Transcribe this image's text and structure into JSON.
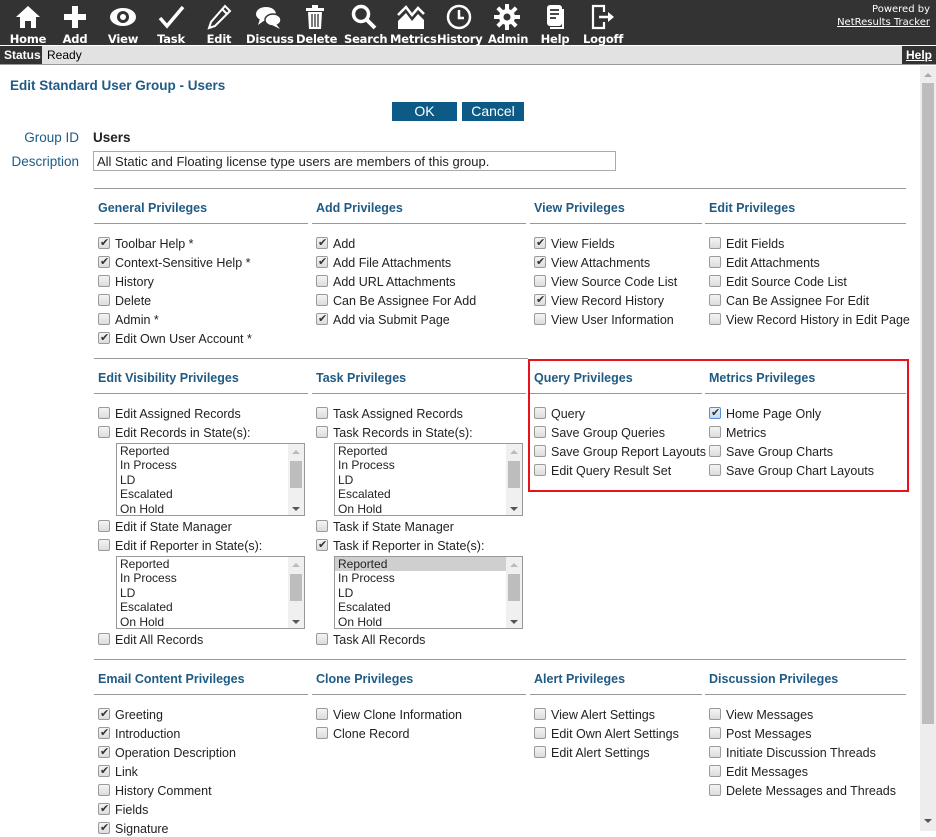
{
  "toolbar": {
    "items": [
      {
        "label": "Home",
        "icon": "home-icon"
      },
      {
        "label": "Add",
        "icon": "plus-icon"
      },
      {
        "label": "View",
        "icon": "eye-icon"
      },
      {
        "label": "Task",
        "icon": "checkmark-icon"
      },
      {
        "label": "Edit",
        "icon": "pencil-icon"
      },
      {
        "label": "Discuss",
        "icon": "chat-bubbles-icon"
      },
      {
        "label": "Delete",
        "icon": "trash-icon"
      },
      {
        "label": "Search",
        "icon": "magnifier-icon"
      },
      {
        "label": "Metrics",
        "icon": "chart-icon"
      },
      {
        "label": "History",
        "icon": "clock-icon"
      },
      {
        "label": "Admin",
        "icon": "gear-icon"
      },
      {
        "label": "Help",
        "icon": "document-icon"
      },
      {
        "label": "Logoff",
        "icon": "logoff-icon"
      }
    ],
    "powered_by": "Powered by",
    "brand_link": "NetResults Tracker"
  },
  "status": {
    "label": "Status",
    "value": "Ready",
    "help": "Help"
  },
  "page": {
    "title": "Edit Standard User Group - Users",
    "ok": "OK",
    "cancel": "Cancel",
    "group_id_label": "Group ID",
    "group_id": "Users",
    "description_label": "Description",
    "description": "All Static and Floating license type users are members of this group."
  },
  "state_options": [
    "Reported",
    "In Process",
    "LD",
    "Escalated",
    "On Hold"
  ],
  "sections": {
    "general": {
      "title": "General Privileges",
      "items": [
        {
          "label": "Toolbar Help *",
          "checked": true
        },
        {
          "label": "Context-Sensitive Help *",
          "checked": true
        },
        {
          "label": "History",
          "checked": false
        },
        {
          "label": "Delete",
          "checked": false
        },
        {
          "label": "Admin *",
          "checked": false
        },
        {
          "label": "Edit Own User Account *",
          "checked": true
        }
      ]
    },
    "add": {
      "title": "Add Privileges",
      "items": [
        {
          "label": "Add",
          "checked": true
        },
        {
          "label": "Add File Attachments",
          "checked": true
        },
        {
          "label": "Add URL Attachments",
          "checked": false
        },
        {
          "label": "Can Be Assignee For Add",
          "checked": false
        },
        {
          "label": "Add via Submit Page",
          "checked": true
        }
      ]
    },
    "view": {
      "title": "View Privileges",
      "items": [
        {
          "label": "View Fields",
          "checked": true
        },
        {
          "label": "View Attachments",
          "checked": true
        },
        {
          "label": "View Source Code List",
          "checked": false
        },
        {
          "label": "View Record History",
          "checked": true
        },
        {
          "label": "View User Information",
          "checked": false
        }
      ]
    },
    "edit": {
      "title": "Edit Privileges",
      "items": [
        {
          "label": "Edit Fields",
          "checked": false
        },
        {
          "label": "Edit Attachments",
          "checked": false
        },
        {
          "label": "Edit Source Code List",
          "checked": false
        },
        {
          "label": "Can Be Assignee For Edit",
          "checked": false
        },
        {
          "label": "View Record History in Edit Page",
          "checked": false
        }
      ]
    },
    "edit_visibility": {
      "title": "Edit Visibility Privileges",
      "items": [
        {
          "label": "Edit Assigned Records",
          "checked": false
        },
        {
          "label": "Edit Records in State(s):",
          "checked": false
        },
        {
          "label": "Edit if State Manager",
          "checked": false
        },
        {
          "label": "Edit if Reporter in State(s):",
          "checked": false
        },
        {
          "label": "Edit All Records",
          "checked": false
        }
      ]
    },
    "task": {
      "title": "Task Privileges",
      "items": [
        {
          "label": "Task Assigned Records",
          "checked": false
        },
        {
          "label": "Task Records in State(s):",
          "checked": false
        },
        {
          "label": "Task if State Manager",
          "checked": false
        },
        {
          "label": "Task if Reporter in State(s):",
          "checked": true
        },
        {
          "label": "Task All Records",
          "checked": false
        }
      ],
      "reporter_selected": "Reported"
    },
    "query": {
      "title": "Query Privileges",
      "items": [
        {
          "label": "Query",
          "checked": false
        },
        {
          "label": "Save Group Queries",
          "checked": false
        },
        {
          "label": "Save Group Report Layouts",
          "checked": false
        },
        {
          "label": "Edit Query Result Set",
          "checked": false
        }
      ]
    },
    "metrics": {
      "title": "Metrics Privileges",
      "items": [
        {
          "label": "Home Page Only",
          "checked": true
        },
        {
          "label": "Metrics",
          "checked": false
        },
        {
          "label": "Save Group Charts",
          "checked": false
        },
        {
          "label": "Save Group Chart Layouts",
          "checked": false
        }
      ]
    },
    "email": {
      "title": "Email Content Privileges",
      "items": [
        {
          "label": "Greeting",
          "checked": true
        },
        {
          "label": "Introduction",
          "checked": true
        },
        {
          "label": "Operation Description",
          "checked": true
        },
        {
          "label": "Link",
          "checked": true
        },
        {
          "label": "History Comment",
          "checked": false
        },
        {
          "label": "Fields",
          "checked": true
        },
        {
          "label": "Signature",
          "checked": true
        }
      ]
    },
    "clone": {
      "title": "Clone Privileges",
      "items": [
        {
          "label": "View Clone Information",
          "checked": false
        },
        {
          "label": "Clone Record",
          "checked": false
        }
      ]
    },
    "alert": {
      "title": "Alert Privileges",
      "items": [
        {
          "label": "View Alert Settings",
          "checked": false
        },
        {
          "label": "Edit Own Alert Settings",
          "checked": false
        },
        {
          "label": "Edit Alert Settings",
          "checked": false
        }
      ]
    },
    "discussion": {
      "title": "Discussion Privileges",
      "items": [
        {
          "label": "View Messages",
          "checked": false
        },
        {
          "label": "Post Messages",
          "checked": false
        },
        {
          "label": "Initiate Discussion Threads",
          "checked": false
        },
        {
          "label": "Edit Messages",
          "checked": false
        },
        {
          "label": "Delete Messages and Threads",
          "checked": false
        }
      ]
    }
  },
  "colors": {
    "toolbar_bg": "#333333",
    "heading": "#1f5b84",
    "button": "#0e5a86",
    "highlight": "#e8121b"
  }
}
